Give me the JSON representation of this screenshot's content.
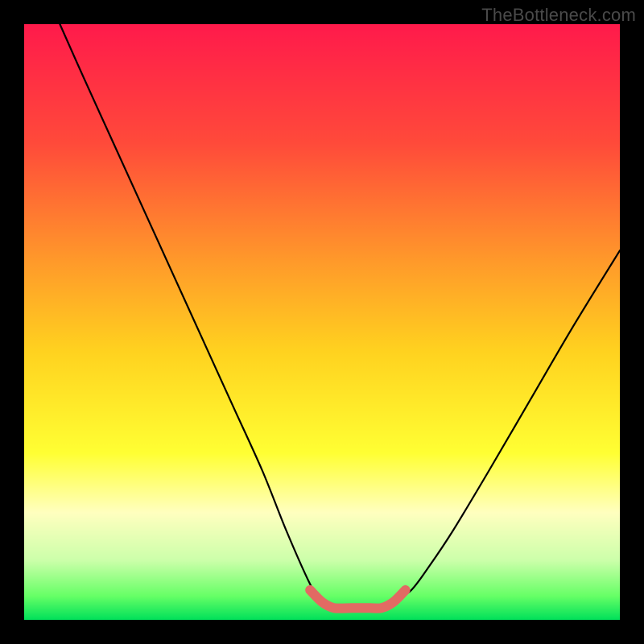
{
  "watermark": "TheBottleneck.com",
  "gradient": {
    "stops": [
      {
        "offset": 0.0,
        "color": "#ff1a4b"
      },
      {
        "offset": 0.2,
        "color": "#ff4a3a"
      },
      {
        "offset": 0.4,
        "color": "#ff9a2a"
      },
      {
        "offset": 0.55,
        "color": "#ffd21f"
      },
      {
        "offset": 0.72,
        "color": "#ffff33"
      },
      {
        "offset": 0.82,
        "color": "#ffffbf"
      },
      {
        "offset": 0.9,
        "color": "#ccffaa"
      },
      {
        "offset": 0.96,
        "color": "#66ff66"
      },
      {
        "offset": 1.0,
        "color": "#00e05a"
      }
    ]
  },
  "chart_data": {
    "type": "line",
    "title": "",
    "xlabel": "",
    "ylabel": "",
    "xlim": [
      0,
      100
    ],
    "ylim": [
      0,
      100
    ],
    "series": [
      {
        "name": "curve",
        "x": [
          6,
          10,
          15,
          20,
          25,
          30,
          35,
          40,
          44,
          48,
          50,
          52,
          55,
          58,
          60,
          62,
          65,
          68,
          72,
          78,
          85,
          92,
          100
        ],
        "y": [
          100,
          91,
          80,
          69,
          58,
          47,
          36,
          25,
          15,
          6,
          3,
          2,
          2,
          2,
          2,
          3,
          5,
          9,
          15,
          25,
          37,
          49,
          62
        ]
      }
    ],
    "overlay_segment": {
      "name": "highlighted-minimum",
      "color": "#e26a63",
      "x": [
        48,
        50,
        52,
        55,
        58,
        60,
        62,
        64
      ],
      "y": [
        5,
        3,
        2,
        2,
        2,
        2,
        3,
        5
      ]
    }
  }
}
